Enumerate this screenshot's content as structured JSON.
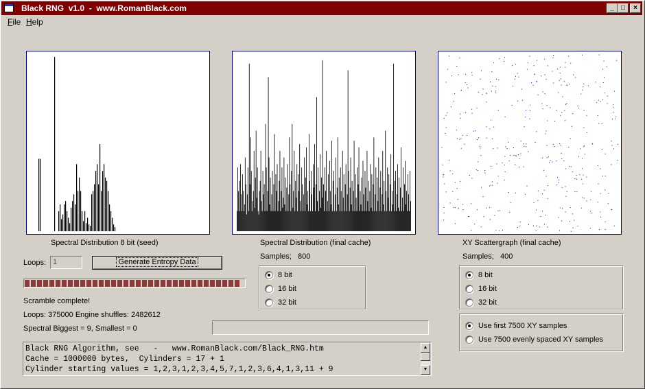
{
  "window": {
    "title": "Black RNG  v1.0  -  www.RomanBlack.com",
    "minimize": "_",
    "maximize": "□",
    "close": "×"
  },
  "menu": [
    {
      "label": "File",
      "accel": "F",
      "rest": "ile"
    },
    {
      "label": "Help",
      "accel": "H",
      "rest": "elp"
    }
  ],
  "chart_data": [
    {
      "type": "bar",
      "xlabel": "Spectral Distribution 8 bit (seed)",
      "ylim": [
        0,
        260
      ],
      "values": [
        0,
        0,
        0,
        0,
        0,
        0,
        0,
        0,
        0,
        0,
        0,
        0,
        0,
        0,
        0,
        0,
        0,
        0,
        0,
        0,
        0,
        0,
        0,
        0,
        0,
        0,
        0,
        0,
        0,
        0,
        0,
        0,
        0,
        0,
        0,
        0,
        0,
        0,
        0,
        0,
        0,
        0,
        0,
        0,
        0,
        0,
        0,
        0,
        0,
        0,
        0,
        0,
        0,
        0,
        0,
        0,
        0,
        0,
        0,
        0,
        0,
        0,
        0,
        0,
        0,
        0,
        0,
        0,
        0,
        0,
        0,
        0,
        0,
        0,
        0,
        0,
        0,
        0,
        0,
        0,
        0,
        0,
        0,
        0,
        0,
        0,
        0,
        0,
        0,
        0,
        0,
        0,
        0,
        0,
        0,
        0,
        0,
        0,
        0,
        0,
        0,
        0,
        0,
        0,
        0,
        0,
        0,
        0,
        0,
        0,
        0,
        0,
        0,
        0,
        0,
        0,
        0,
        0,
        0,
        0,
        0,
        0,
        0,
        0,
        0,
        0,
        0,
        0,
        0,
        0,
        0,
        0,
        0,
        0,
        0,
        0,
        0,
        0,
        0,
        0,
        0,
        0,
        0,
        0,
        0,
        0,
        0,
        0,
        0,
        0,
        0,
        0,
        0,
        0,
        0,
        0,
        0,
        0,
        0,
        0,
        0,
        0,
        0,
        0,
        0,
        0,
        0,
        0,
        0,
        0,
        0,
        0,
        0,
        0,
        0,
        0,
        0,
        0,
        0,
        0,
        0,
        0,
        0,
        0,
        0,
        0,
        0,
        0,
        0,
        0,
        0,
        0,
        0,
        0,
        0,
        0,
        0,
        0,
        0,
        0,
        0,
        0,
        0,
        0,
        0,
        0,
        0,
        0,
        0,
        0,
        0,
        0,
        0,
        0,
        0,
        0,
        0,
        0,
        0,
        0,
        0,
        0,
        0,
        0,
        0,
        0,
        0,
        0,
        0,
        0,
        0,
        0,
        0,
        0,
        0,
        0,
        0,
        0,
        0,
        0,
        0,
        0,
        0,
        0,
        0,
        0,
        0,
        0,
        0,
        0,
        0,
        0,
        0,
        0,
        0,
        0
      ],
      "peaks": [
        [
          13,
          108
        ],
        [
          15,
          108
        ],
        [
          36,
          260
        ],
        [
          42,
          30
        ],
        [
          44,
          40
        ],
        [
          46,
          18
        ],
        [
          48,
          25
        ],
        [
          50,
          40
        ],
        [
          52,
          45
        ],
        [
          54,
          30
        ],
        [
          56,
          20
        ],
        [
          58,
          12
        ],
        [
          60,
          35
        ],
        [
          62,
          45
        ],
        [
          64,
          55
        ],
        [
          66,
          40
        ],
        [
          68,
          100
        ],
        [
          70,
          60
        ],
        [
          72,
          80
        ],
        [
          74,
          60
        ],
        [
          76,
          30
        ],
        [
          78,
          15
        ],
        [
          80,
          30
        ],
        [
          82,
          12
        ],
        [
          84,
          20
        ],
        [
          86,
          10
        ],
        [
          88,
          8
        ],
        [
          90,
          55
        ],
        [
          92,
          60
        ],
        [
          94,
          70
        ],
        [
          96,
          90
        ],
        [
          98,
          100
        ],
        [
          100,
          70
        ],
        [
          102,
          130
        ],
        [
          104,
          60
        ],
        [
          106,
          90
        ],
        [
          108,
          100
        ],
        [
          110,
          80
        ],
        [
          112,
          75
        ],
        [
          114,
          60
        ],
        [
          116,
          40
        ],
        [
          118,
          30
        ],
        [
          120,
          20
        ],
        [
          122,
          10
        ],
        [
          124,
          6
        ]
      ]
    },
    {
      "type": "bar",
      "xlabel": "Spectral Distribution (final cache)",
      "ylim": [
        0,
        260
      ],
      "samples": 800,
      "values": [
        30,
        95,
        60,
        30,
        75,
        100,
        55,
        30,
        85,
        60,
        30,
        40,
        110,
        70,
        25,
        55,
        95,
        30,
        250,
        70,
        140,
        90,
        30,
        45,
        60,
        120,
        35,
        80,
        150,
        50,
        95,
        30,
        25,
        60,
        75,
        120,
        45,
        30,
        90,
        55,
        70,
        30,
        160,
        95,
        30,
        60,
        230,
        110,
        40,
        80,
        30,
        55,
        90,
        30,
        70,
        145,
        30,
        85,
        60,
        100,
        30,
        45,
        75,
        120,
        30,
        60,
        95,
        35,
        50,
        110,
        40,
        80,
        30,
        65,
        100,
        30,
        55,
        140,
        70,
        30,
        90,
        160,
        35,
        60,
        120,
        30,
        75,
        50,
        100,
        30,
        85,
        60,
        130,
        45,
        30,
        95,
        70,
        30,
        55,
        110,
        30,
        80,
        125,
        40,
        60,
        30,
        145,
        75,
        30,
        90,
        55,
        30,
        100,
        65,
        130,
        30,
        70,
        200,
        45,
        95,
        30,
        60,
        115,
        35,
        80,
        50,
        255,
        70,
        30,
        95,
        60,
        120,
        30,
        45,
        85,
        30,
        105,
        60,
        40,
        135,
        30,
        75,
        90,
        30,
        55,
        110,
        30,
        65,
        140,
        40,
        80,
        30,
        95,
        60,
        30,
        120,
        50,
        85,
        30,
        70,
        100,
        30,
        55,
        240,
        90,
        30,
        65,
        110,
        40,
        75,
        30,
        60,
        135,
        30,
        85,
        50,
        30,
        95,
        70,
        125,
        30,
        60,
        40,
        80,
        30,
        105,
        55,
        30,
        90,
        65,
        30,
        120,
        45,
        75,
        30,
        60,
        100,
        35,
        85,
        30,
        70,
        140,
        30,
        55,
        95,
        30,
        80,
        45,
        110,
        30,
        65,
        90,
        30,
        55,
        120,
        40,
        75,
        30,
        150,
        60,
        30,
        95,
        50,
        85,
        30,
        70,
        115,
        30,
        60,
        40,
        250,
        30,
        75,
        90,
        30,
        55,
        100,
        35,
        80,
        30,
        65,
        125,
        30,
        50,
        95,
        30,
        70,
        105,
        40,
        60,
        30,
        85,
        55,
        30,
        90,
        45
      ]
    },
    {
      "type": "scatter",
      "xlabel": "XY Scattergraph (final cache)",
      "samples": 400,
      "xlim": [
        0,
        255
      ],
      "ylim": [
        0,
        255
      ],
      "color": "#0000a0",
      "point_count": 400
    }
  ],
  "panel1": {
    "caption": "Spectral Distribution 8 bit (seed)",
    "loops_label": "Loops:",
    "loops_value": "1",
    "generate_button": "Generate Entropy Data",
    "progress_percent": 100,
    "status": "Scramble complete!",
    "stats_loops": "Loops: 375000  Engine shuffles: 2482612",
    "stats_spectral": "Spectral Biggest = 9, Smallest = 0"
  },
  "panel2": {
    "caption": "Spectral Distribution (final cache)",
    "samples_label": "Samples;",
    "samples_value": "800",
    "bit_options": [
      "8 bit",
      "16 bit",
      "32 bit"
    ],
    "selected_bits": "8 bit"
  },
  "panel3": {
    "caption": "XY Scattergraph (final cache)",
    "samples_label": "Samples;",
    "samples_value": "400",
    "bit_options": [
      "8 bit",
      "16 bit",
      "32 bit"
    ],
    "selected_bits": "8 bit",
    "sample_mode_options": [
      "Use first 7500 XY samples",
      "Use 7500 evenly spaced XY samples"
    ],
    "selected_mode": "Use first 7500 XY samples"
  },
  "memo": {
    "lines": [
      "Black RNG Algorithm, see   -   www.RomanBlack.com/Black_RNG.htm",
      "Cache = 1000000 bytes,  Cylinders = 17 + 1",
      "Cylinder starting values = 1,2,3,1,2,3,4,5,7,1,2,3,6,4,1,3,11 + 9"
    ]
  },
  "colors": {
    "titlebar": "#7f0000",
    "progress_fill": "#8b3a3a",
    "scatter_dot": "#0000a0",
    "panel_border": "#000080"
  }
}
